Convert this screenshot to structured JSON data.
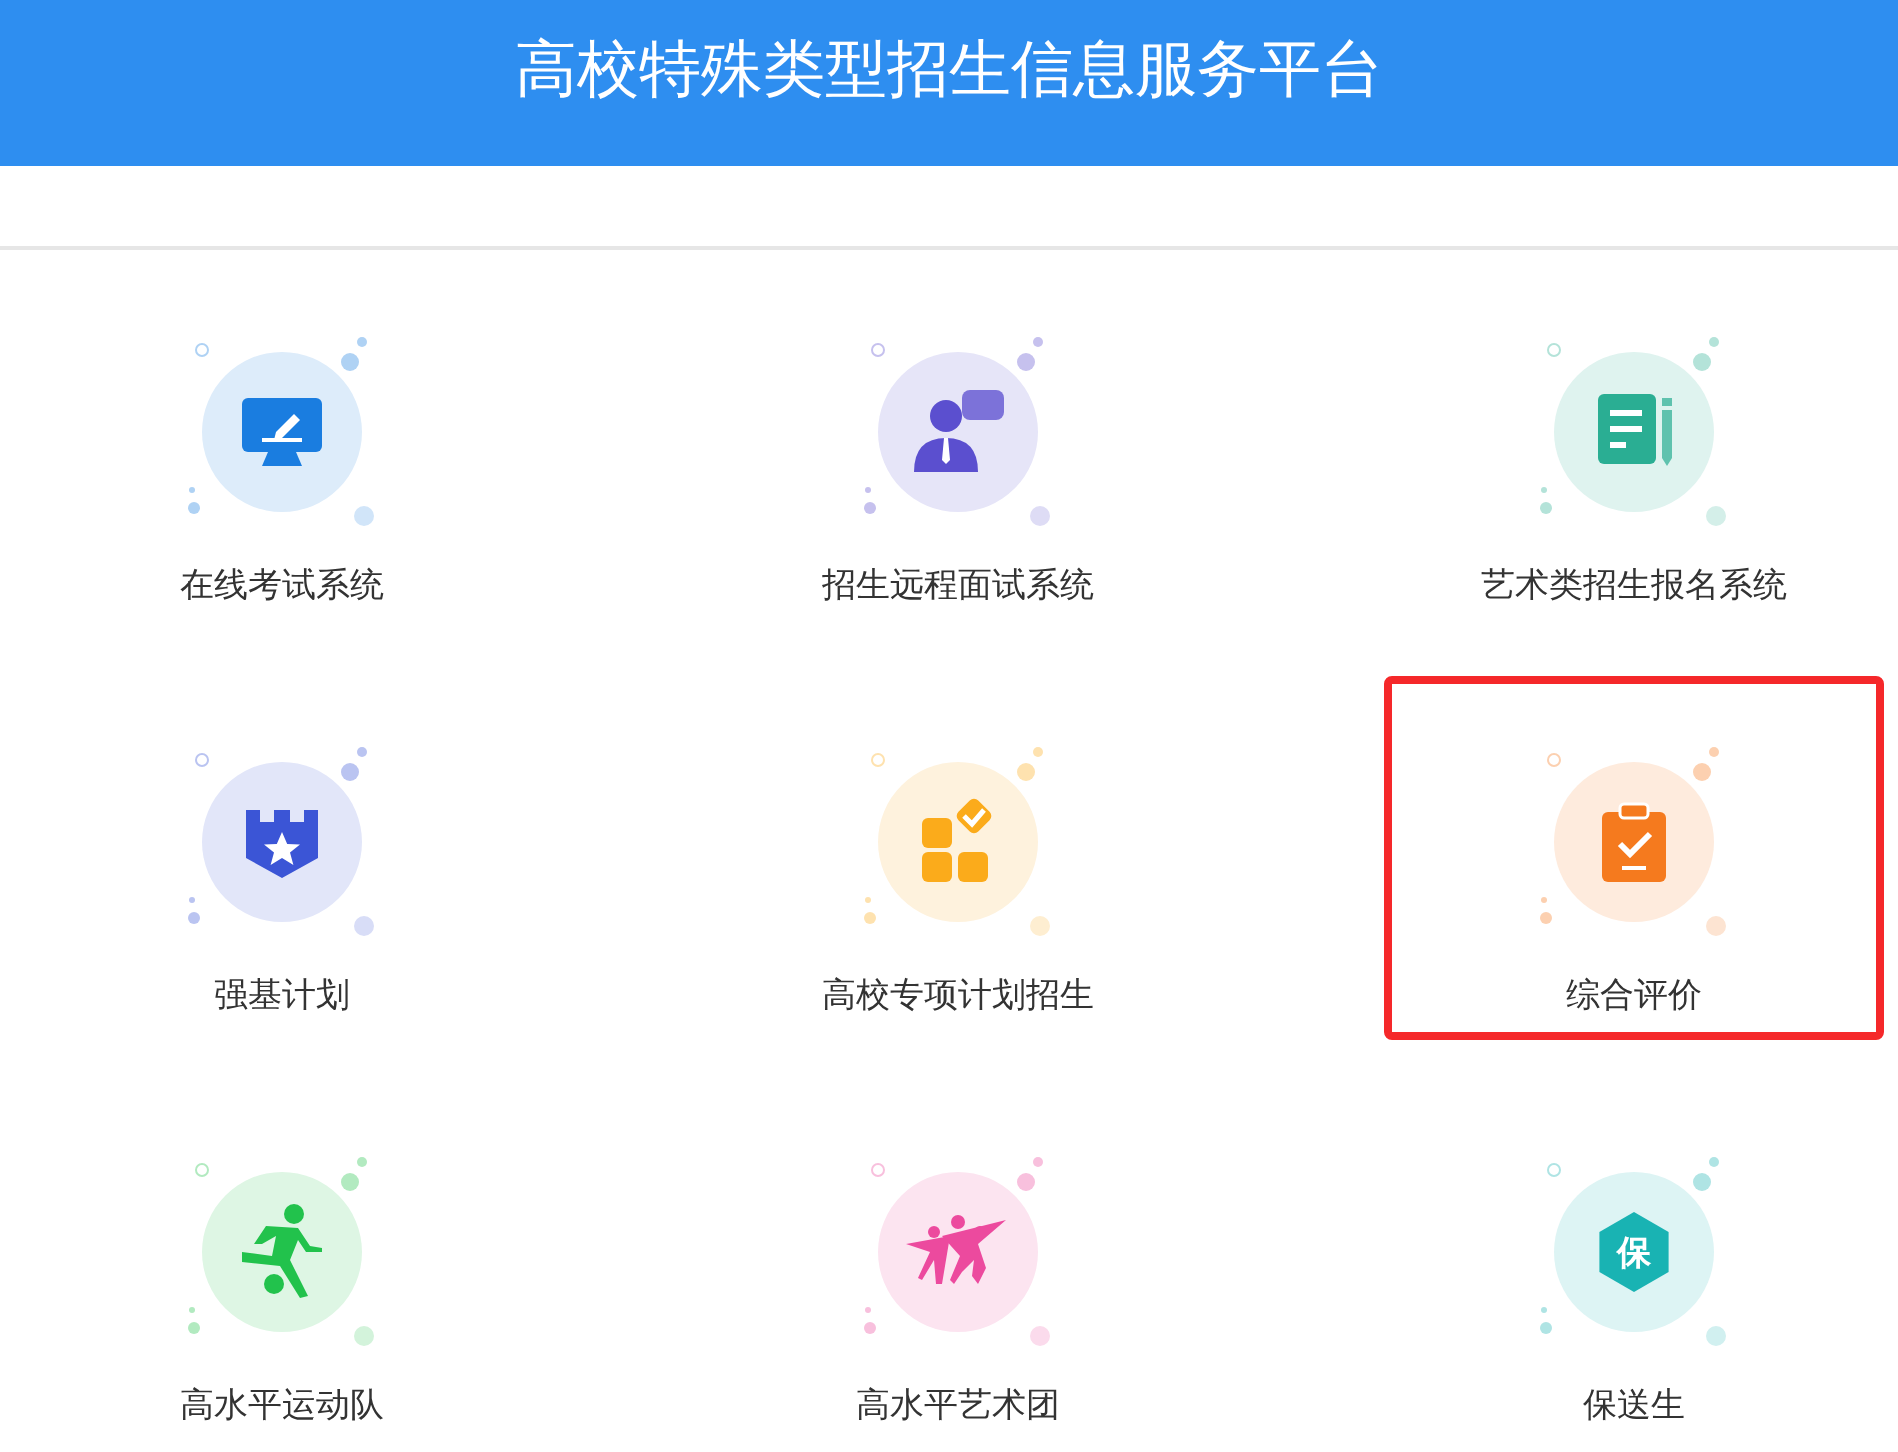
{
  "header": {
    "title": "高校特殊类型招生信息服务平台"
  },
  "rows": [
    {
      "items": [
        {
          "label": "在线考试系统",
          "kind": "monitor",
          "color": "#1a7de0",
          "highlighted": false
        },
        {
          "label": "招生远程面试系统",
          "kind": "person",
          "color": "#5b4fcf",
          "highlighted": false
        },
        {
          "label": "艺术类招生报名系统",
          "kind": "document",
          "color": "#2aae93",
          "highlighted": false
        }
      ]
    },
    {
      "items": [
        {
          "label": "强基计划",
          "kind": "shield",
          "color": "#3b55d6",
          "highlighted": false
        },
        {
          "label": "高校专项计划招生",
          "kind": "blocks",
          "color": "#fbab1b",
          "highlighted": false
        },
        {
          "label": "综合评价",
          "kind": "clipboard",
          "color": "#f57a1e",
          "highlighted": true
        }
      ]
    },
    {
      "items": [
        {
          "label": "高水平运动队",
          "kind": "runner",
          "color": "#22c24c",
          "highlighted": false
        },
        {
          "label": "高水平艺术团",
          "kind": "dancers",
          "color": "#ec4a9e",
          "highlighted": false
        },
        {
          "label": "保送生",
          "kind": "hexagon",
          "badge_text": "保",
          "color": "#19b3b3",
          "highlighted": false
        }
      ]
    }
  ]
}
